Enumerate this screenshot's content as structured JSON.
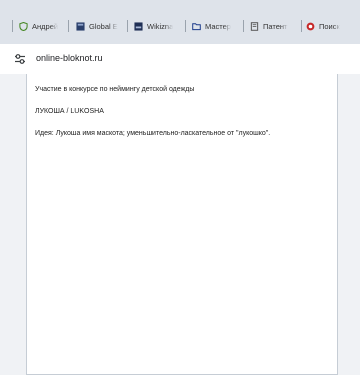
{
  "tabs": [
    {
      "label": "Андрей",
      "favicon": "shield-icon",
      "color": "#4a8a2a"
    },
    {
      "label": "Global E",
      "favicon": "grid-icon",
      "color": "#2a3f6b"
    },
    {
      "label": "Wikizna",
      "favicon": "grid-icon",
      "color": "#1f2f55"
    },
    {
      "label": "Мастер",
      "favicon": "folder-icon",
      "color": "#1a3a8a"
    },
    {
      "label": "Патент",
      "favicon": "document-icon",
      "color": "#555555"
    },
    {
      "label": "Поиск",
      "favicon": "search-icon",
      "color": "#c62828"
    }
  ],
  "address_bar": {
    "site_info_icon": "tune-icon",
    "url": "online-bloknot.ru"
  },
  "notepad": {
    "lines": [
      "Участие в конкурсе по неймингу детской одежды",
      "ЛУКОША / LUKOSHA",
      "Идея: Лукоша имя  маскота; уменьшительно-ласкательное от \"лукошко\"."
    ]
  }
}
